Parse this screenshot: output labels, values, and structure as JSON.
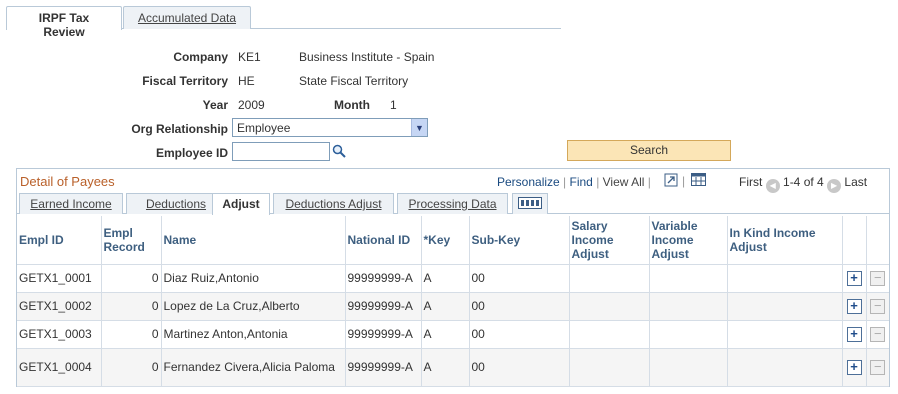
{
  "page_tabs": [
    "IRPF Tax Review",
    "Accumulated Data"
  ],
  "form": {
    "company_label": "Company",
    "company_code": "KE1",
    "company_name": "Business Institute - Spain",
    "fiscal_label": "Fiscal Territory",
    "fiscal_code": "HE",
    "fiscal_name": "State Fiscal Territory",
    "year_label": "Year",
    "year_value": "2009",
    "month_label": "Month",
    "month_value": "1",
    "org_label": "Org Relationship",
    "org_value": "Employee",
    "empl_id_label": "Employee ID",
    "empl_id_value": "",
    "search_label": "Search"
  },
  "grid": {
    "title": "Detail of Payees",
    "nav_links": [
      "Personalize",
      "Find",
      "View All"
    ],
    "first": "First",
    "range": "1-4 of 4",
    "last": "Last",
    "tabs": [
      "Earned Income",
      "Deductions",
      "Adjust",
      "Deductions Adjust",
      "Processing Data"
    ],
    "columns": [
      "Empl ID",
      "Empl Record",
      "Name",
      "National ID",
      "*Key",
      "Sub-Key",
      "Salary Income Adjust",
      "Variable Income Adjust",
      "In Kind Income Adjust"
    ],
    "rows": [
      {
        "empl_id": "GETX1_0001",
        "record": "0",
        "name": "Diaz Ruiz,Antonio",
        "national_id": "99999999-A",
        "key": "A",
        "subkey": "00"
      },
      {
        "empl_id": "GETX1_0002",
        "record": "0",
        "name": "Lopez de La Cruz,Alberto",
        "national_id": "99999999-A",
        "key": "A",
        "subkey": "00"
      },
      {
        "empl_id": "GETX1_0003",
        "record": "0",
        "name": "Martinez Anton,Antonia",
        "national_id": "99999999-A",
        "key": "A",
        "subkey": "00"
      },
      {
        "empl_id": "GETX1_0004",
        "record": "0",
        "name": "Fernandez Civera,Alicia Paloma",
        "national_id": "99999999-A",
        "key": "A",
        "subkey": "00"
      }
    ]
  },
  "icons": {
    "lookup": "magnifier-icon",
    "download": "download-grid-icon",
    "zoom": "zoom-grid-icon",
    "first_arrow": "arrow-left-icon",
    "last_arrow": "arrow-right-icon",
    "show_all_columns": "show-all-columns-icon",
    "add_row": "add-row-icon",
    "delete_row": "delete-row-icon"
  },
  "colors": {
    "grid_title": "#b9602a",
    "search_button": "#fbe5b6",
    "header_text": "#3e5f80",
    "link": "#1a4a80"
  }
}
